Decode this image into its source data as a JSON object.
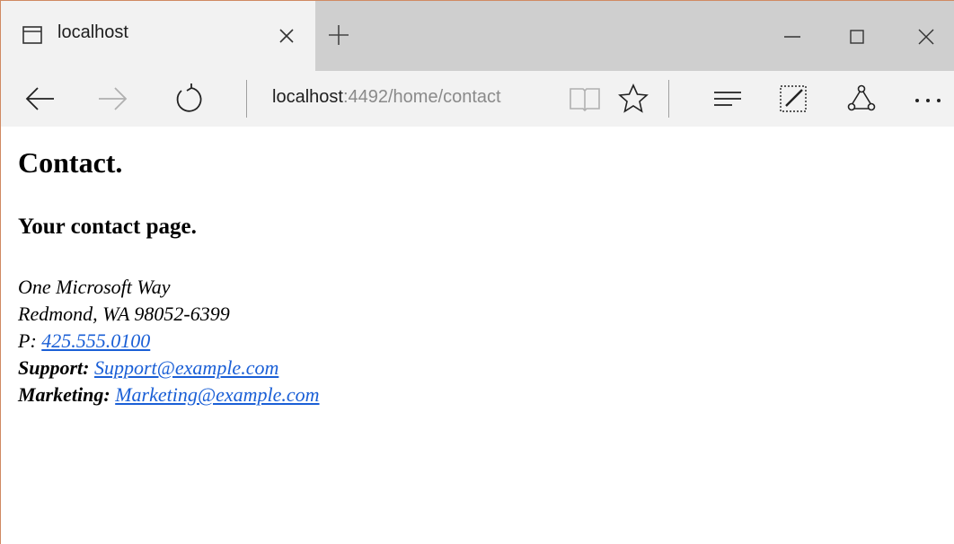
{
  "browser": {
    "tab": {
      "title": "localhost"
    },
    "address": {
      "host": "localhost",
      "rest": ":4492/home/contact"
    }
  },
  "icons": {
    "tab": "tab-page-icon",
    "tab_close": "close-icon",
    "new_tab": "plus-icon",
    "minimize": "minimize-icon",
    "maximize": "maximize-icon",
    "close_window": "close-icon",
    "back": "back-arrow-icon",
    "forward": "forward-arrow-icon",
    "refresh": "refresh-icon",
    "reading_view": "book-icon",
    "favorite": "star-icon",
    "hub": "hub-icon",
    "web_note": "pen-note-icon",
    "share": "share-icon",
    "more": "more-icon"
  },
  "colors": {
    "link": "#1a5fd6",
    "tab_active": "#f2f2f2",
    "titlebar": "#cfcfcf"
  },
  "page": {
    "title": "Contact.",
    "subtitle": "Your contact page.",
    "address": {
      "line1": "One Microsoft Way",
      "line2": "Redmond, WA 98052-6399",
      "phone_label": "P:",
      "phone": "425.555.0100",
      "support_label": "Support:",
      "support_email": "Support@example.com",
      "marketing_label": "Marketing:",
      "marketing_email": "Marketing@example.com"
    }
  }
}
